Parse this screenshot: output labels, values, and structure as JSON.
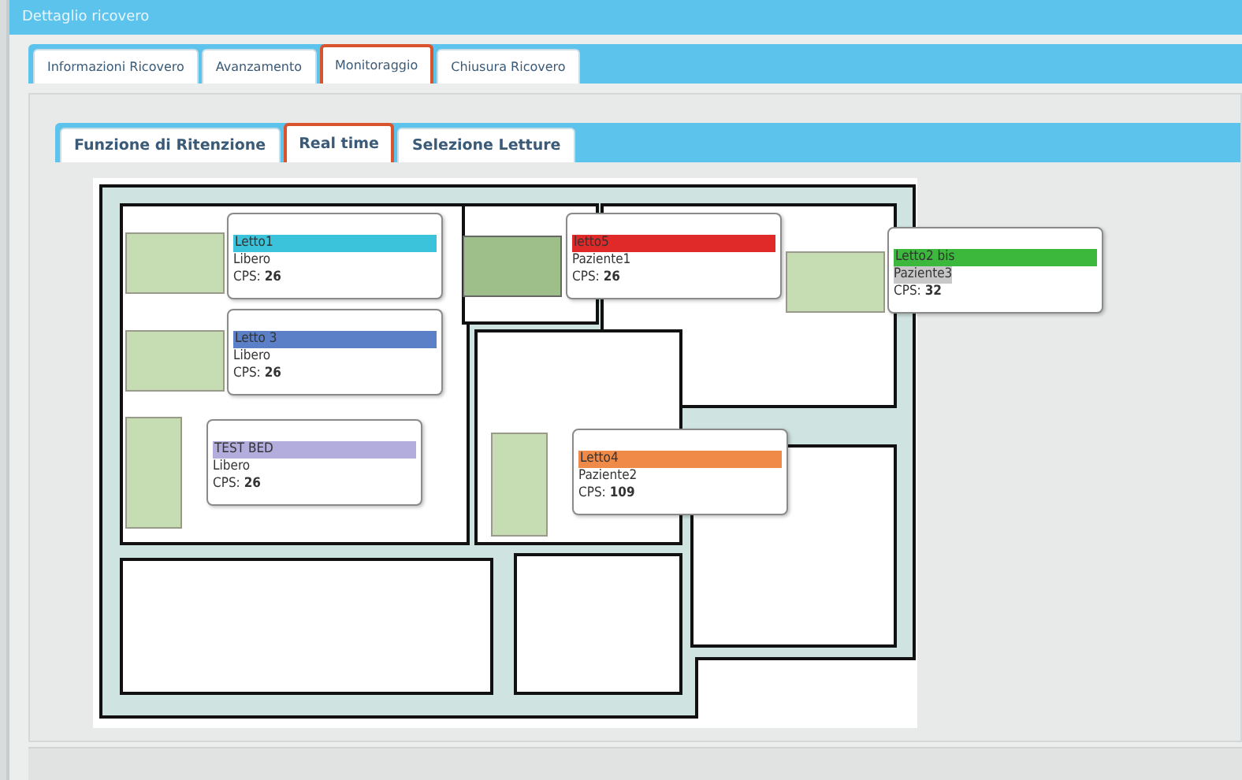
{
  "window": {
    "title": "Dettaglio ricovero"
  },
  "tabs": [
    {
      "label": "Informazioni Ricovero",
      "selected": false
    },
    {
      "label": "Avanzamento",
      "selected": false
    },
    {
      "label": "Monitoraggio",
      "selected": true
    },
    {
      "label": "Chiusura Ricovero",
      "selected": false
    }
  ],
  "subtabs": [
    {
      "label": "Funzione di Ritenzione",
      "selected": false
    },
    {
      "label": "Real time",
      "selected": true
    },
    {
      "label": "Selezione Letture",
      "selected": false
    }
  ],
  "beds": [
    {
      "name": "Letto1",
      "patient": "Libero",
      "patient_highlighted": false,
      "cps_label": "CPS:",
      "cps": "26",
      "color": "#3cc3dc"
    },
    {
      "name": "Letto 3",
      "patient": "Libero",
      "patient_highlighted": false,
      "cps_label": "CPS:",
      "cps": "26",
      "color": "#5b80c8"
    },
    {
      "name": "TEST BED",
      "patient": "Libero",
      "patient_highlighted": false,
      "cps_label": "CPS:",
      "cps": "26",
      "color": "#b2addc"
    },
    {
      "name": "letto5",
      "patient": "Paziente1",
      "patient_highlighted": false,
      "cps_label": "CPS:",
      "cps": "26",
      "color": "#e02a2a"
    },
    {
      "name": "Letto2 bis",
      "patient": "Paziente3",
      "patient_highlighted": true,
      "cps_label": "CPS:",
      "cps": "32",
      "color": "#3cb83c"
    },
    {
      "name": "Letto4",
      "patient": "Paziente2",
      "patient_highlighted": false,
      "cps_label": "CPS:",
      "cps": "109",
      "color": "#f08a48"
    }
  ]
}
